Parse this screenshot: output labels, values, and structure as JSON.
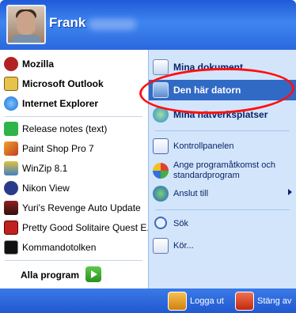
{
  "user": {
    "name": "Frank"
  },
  "left": {
    "pinned": [
      {
        "label": "Mozilla",
        "icon": "mozilla-icon"
      },
      {
        "label": "Microsoft Outlook",
        "icon": "outlook-icon"
      },
      {
        "label": "Internet Explorer",
        "icon": "internet-explorer-icon"
      }
    ],
    "recent": [
      {
        "label": "Release notes (text)",
        "icon": "notes-icon"
      },
      {
        "label": "Paint Shop Pro 7",
        "icon": "paint-shop-pro-icon"
      },
      {
        "label": "WinZip 8.1",
        "icon": "winzip-icon"
      },
      {
        "label": "Nikon View",
        "icon": "nikon-view-icon"
      },
      {
        "label": "Yuri's Revenge Auto Update",
        "icon": "yuris-revenge-icon"
      },
      {
        "label": "Pretty Good Solitaire Quest E...",
        "icon": "solitaire-icon"
      },
      {
        "label": "Kommandotolken",
        "icon": "command-prompt-icon"
      }
    ],
    "all_programs": "Alla program"
  },
  "right": {
    "items": [
      {
        "label": "Mina dokument",
        "icon": "documents-icon"
      },
      {
        "label": "Den här datorn",
        "icon": "computer-icon"
      },
      {
        "label": "Mina nätverksplatser",
        "icon": "network-icon"
      },
      {
        "label": "Kontrollpanelen",
        "icon": "control-panel-icon"
      },
      {
        "label": "Ange programåtkomst och standardprogram",
        "icon": "program-access-icon"
      },
      {
        "label": "Anslut till",
        "icon": "connect-icon"
      },
      {
        "label": "Sök",
        "icon": "search-icon"
      },
      {
        "label": "Kör...",
        "icon": "run-icon"
      }
    ]
  },
  "footer": {
    "logoff": "Logga ut",
    "shutdown": "Stäng av"
  },
  "colors": {
    "selection": "#316ac5",
    "annotation": "#ff1010",
    "header": "#2a68de"
  }
}
